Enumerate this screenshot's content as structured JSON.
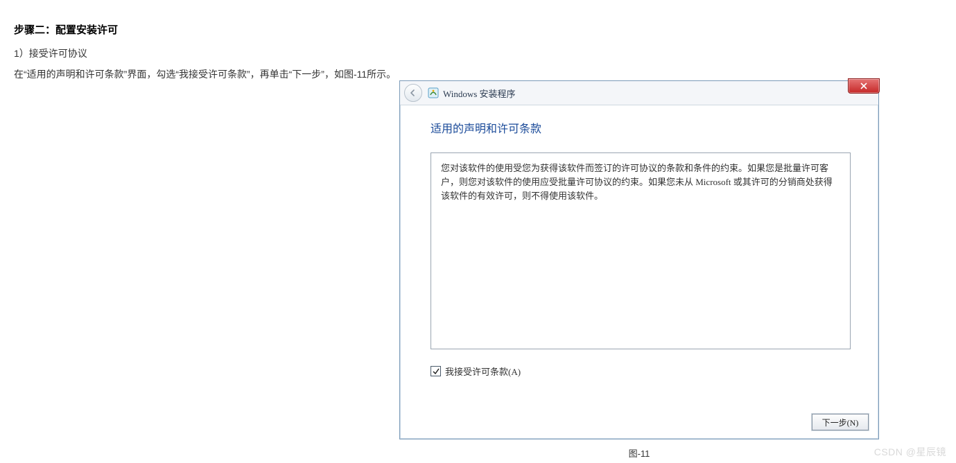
{
  "doc": {
    "step_title": "步骤二：配置安装许可",
    "sub_item": "1）接受许可协议",
    "body_text": "在“适用的声明和许可条款”界面，勾选“我接受许可条款”，再单击“下一步”，如图-11所示。"
  },
  "dialog": {
    "window_title": "Windows 安装程序",
    "heading": "适用的声明和许可条款",
    "license_text": "您对该软件的使用受您为获得该软件而签订的许可协议的条款和条件的约束。如果您是批量许可客户，则您对该软件的使用应受批量许可协议的约束。如果您未从 Microsoft 或其许可的分销商处获得该软件的有效许可，则不得使用该软件。",
    "accept_label": "我接受许可条款(A)",
    "accept_checked": true,
    "next_label": "下一步(N)"
  },
  "caption": "图-11",
  "watermark": "CSDN @星辰镜"
}
